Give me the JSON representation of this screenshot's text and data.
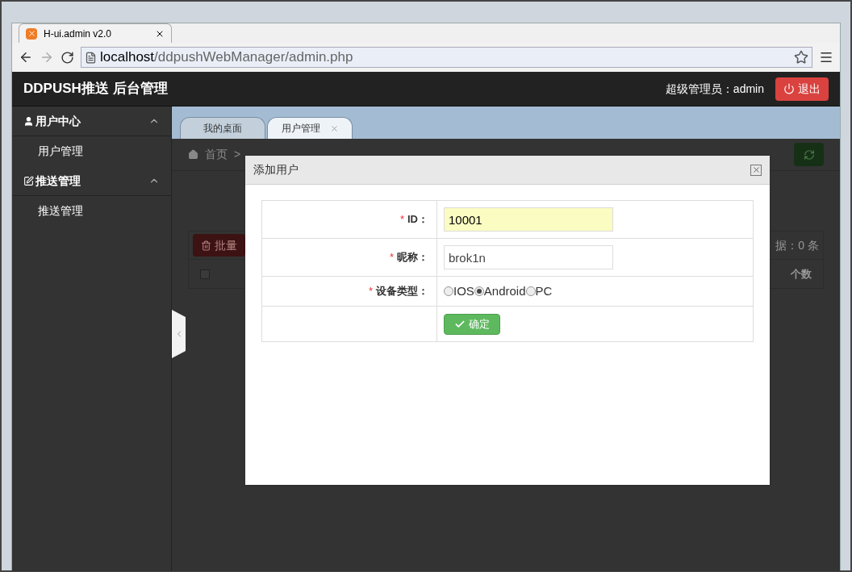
{
  "browser": {
    "tab_title": "H-ui.admin v2.0",
    "url_host": "localhost",
    "url_path": "/ddpushWebManager/admin.php"
  },
  "header": {
    "brand": "DDPUSH推送 后台管理",
    "user": "超级管理员：admin",
    "logout": "退出"
  },
  "sidebar": {
    "groups": [
      {
        "label": "用户中心",
        "kind": "user",
        "expanded": true,
        "children": [
          {
            "label": "用户管理"
          }
        ]
      },
      {
        "label": "推送管理",
        "kind": "edit",
        "expanded": true,
        "children": [
          {
            "label": "推送管理"
          }
        ]
      }
    ]
  },
  "tabs": [
    {
      "label": "我的桌面",
      "selected": false,
      "closable": false
    },
    {
      "label": "用户管理",
      "selected": true,
      "closable": true
    }
  ],
  "breadcrumb": {
    "home": "首页",
    "separator": ">"
  },
  "background_page": {
    "bulk_button": "批量",
    "count_text": "据：0 条",
    "column_text": "个数",
    "select_all_checked": false
  },
  "dialog": {
    "title": "添加用户",
    "fields": [
      {
        "kind": "text",
        "label": "ID：",
        "required_mark": "*",
        "value": "10001",
        "focused": true
      },
      {
        "kind": "text",
        "label": "昵称：",
        "required_mark": "*",
        "value": "brok1n",
        "focused": false
      },
      {
        "kind": "radio",
        "label": "设备类型：",
        "required_mark": "*",
        "options": [
          {
            "label": "IOS",
            "selected": false
          },
          {
            "label": "Android",
            "selected": true
          },
          {
            "label": "PC",
            "selected": false
          }
        ]
      }
    ],
    "submit": "确定"
  }
}
